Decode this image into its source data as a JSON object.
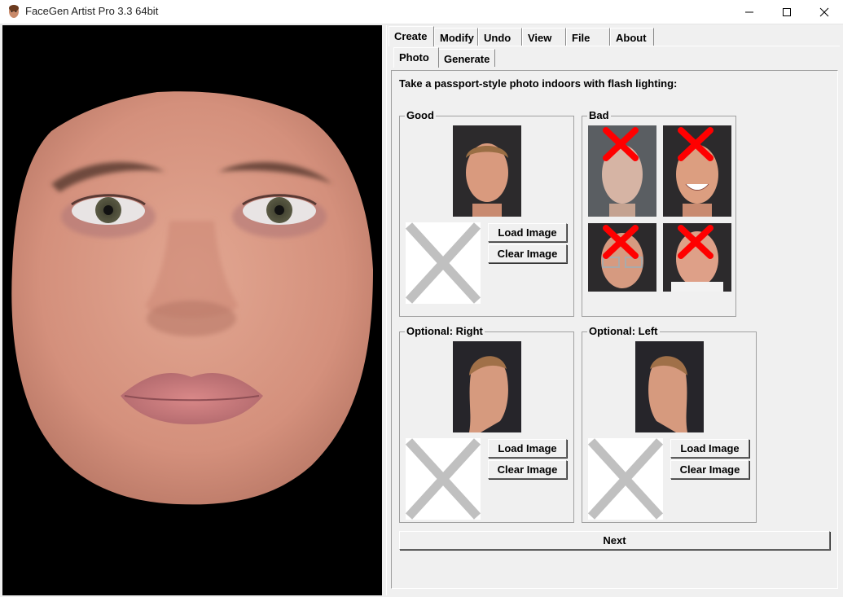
{
  "window": {
    "title": "FaceGen Artist Pro 3.3 64bit"
  },
  "menu_tabs": [
    "Create",
    "Modify",
    "Undo",
    "View",
    "File",
    "About"
  ],
  "sub_tabs": [
    "Photo",
    "Generate"
  ],
  "instruction": "Take a passport-style photo indoors with flash lighting:",
  "groups": {
    "good": "Good",
    "bad": "Bad",
    "optional_right": "Optional: Right",
    "optional_left": "Optional: Left"
  },
  "buttons": {
    "load_image": "Load Image",
    "clear_image": "Clear Image",
    "next": "Next"
  },
  "colors": {
    "background": "#f0f0f0",
    "viewport": "#000000",
    "bad_mark": "#ff0000",
    "placeholder_x": "#c0c0c0"
  }
}
